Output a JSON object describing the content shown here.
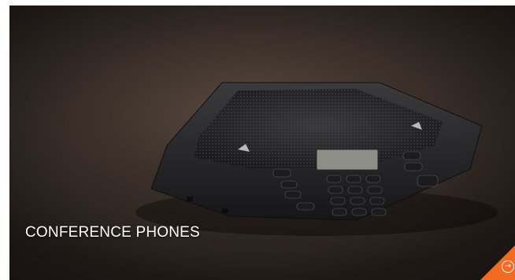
{
  "tile": {
    "caption": "CONFERENCE PHONES",
    "image_subject": "conference-phone",
    "accent_color": "#f26b21",
    "action_icon": "arrow-circle-icon",
    "action_glyph": "→"
  }
}
